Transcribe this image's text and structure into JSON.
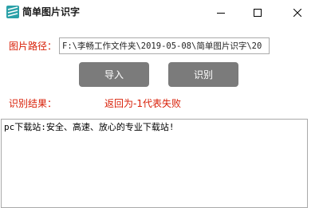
{
  "window": {
    "title": "简单图片识字",
    "icon": "app-logo-icon",
    "controls": [
      "minimize-icon",
      "maximize-icon",
      "close-icon"
    ]
  },
  "path": {
    "label": "图片路径：",
    "value": "F:\\李畅工作文件夹\\2019-05-08\\简单图片识字\\20"
  },
  "buttons": {
    "import_label": "导入",
    "recognize_label": "识别"
  },
  "result": {
    "label": "识别结果：",
    "hint": "返回为-1代表失败",
    "text": "pc下载站:安全、高速、放心的专业下载站!"
  },
  "colors": {
    "label_red": "#d81e06",
    "button_gray": "#7b7b7b",
    "icon_teal": "#2aa1a8"
  }
}
